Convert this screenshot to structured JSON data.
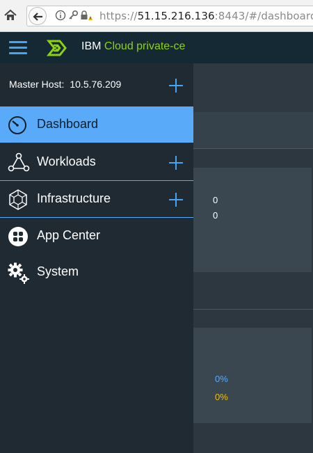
{
  "browser": {
    "url_scheme": "https://",
    "url_host": "51.15.216.136",
    "url_rest": ":8443/#/dashboard/"
  },
  "header": {
    "brand_prefix": "IBM",
    "brand_product": "Cloud private-ce",
    "accent_color": "#8cd211",
    "menu_icon": "hamburger-icon",
    "logo_icon": "ibm-cloud-logo"
  },
  "sidebar": {
    "master_host_label": "Master Host:",
    "master_host_value": "10.5.76.209",
    "items": [
      {
        "label": "Dashboard",
        "icon": "dashboard-gauge-icon",
        "active": true,
        "expandable": false
      },
      {
        "label": "Workloads",
        "icon": "workloads-icon",
        "active": false,
        "expandable": true
      },
      {
        "label": "Infrastructure",
        "icon": "infrastructure-icon",
        "active": false,
        "expandable": true
      },
      {
        "label": "App Center",
        "icon": "app-center-icon",
        "active": false,
        "expandable": false
      },
      {
        "label": "System",
        "icon": "gears-icon",
        "active": false,
        "expandable": false
      }
    ],
    "active_color": "#5aaafa"
  },
  "content": {
    "card1_values": [
      "0",
      "0"
    ],
    "card2_values": [
      {
        "text": "0%",
        "color": "#5aaafa"
      },
      {
        "text": "0%",
        "color": "#efc100"
      }
    ]
  }
}
